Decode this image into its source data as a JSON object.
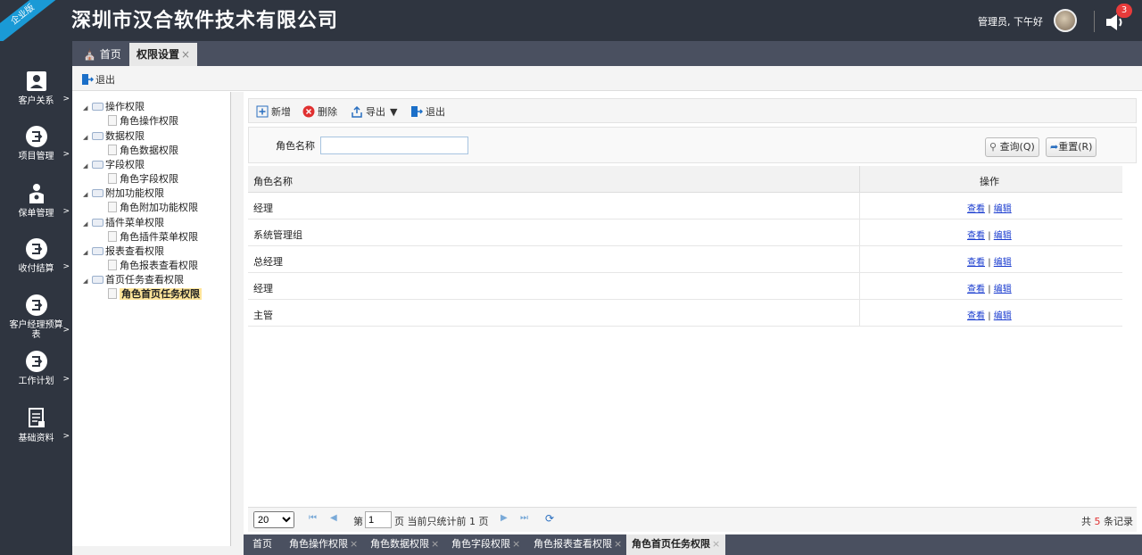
{
  "header": {
    "ribbon": "企业版",
    "company": "深圳市汉合软件技术有限公司",
    "user_greeting": "管理员, 下午好",
    "notification_count": "3"
  },
  "sidebar": {
    "items": [
      {
        "label": "客户关系",
        "icon": "contact-card-icon"
      },
      {
        "label": "项目管理",
        "icon": "module-icon"
      },
      {
        "label": "保单管理",
        "icon": "person-tool-icon"
      },
      {
        "label": "收付结算",
        "icon": "module-icon"
      },
      {
        "label": "客户经理预算表",
        "icon": "module-icon"
      },
      {
        "label": "工作计划",
        "icon": "module-icon"
      },
      {
        "label": "基础资料",
        "icon": "document-icon"
      }
    ],
    "arrow": ">"
  },
  "tabs": [
    {
      "label": "首页"
    },
    {
      "label": "权限设置"
    }
  ],
  "top_toolbar": {
    "exit_label": "退出"
  },
  "tree": {
    "nodes": [
      {
        "label": "操作权限",
        "child": "角色操作权限"
      },
      {
        "label": "数据权限",
        "child": "角色数据权限"
      },
      {
        "label": "字段权限",
        "child": "角色字段权限"
      },
      {
        "label": "附加功能权限",
        "child": "角色附加功能权限"
      },
      {
        "label": "插件菜单权限",
        "child": "角色插件菜单权限"
      },
      {
        "label": "报表查看权限",
        "child": "角色报表查看权限"
      },
      {
        "label": "首页任务查看权限",
        "child": "角色首页任务权限"
      }
    ]
  },
  "toolbar": {
    "new": "新增",
    "delete": "删除",
    "export": "导出",
    "exit": "退出"
  },
  "search": {
    "label": "角色名称",
    "value": "",
    "query_button": "查询(Q)",
    "reset_button": "重置(R)"
  },
  "grid": {
    "columns": [
      "角色名称",
      "操作"
    ],
    "rows": [
      {
        "name": "经理"
      },
      {
        "name": "系统管理组"
      },
      {
        "name": "总经理"
      },
      {
        "name": "经理"
      },
      {
        "name": "主管"
      }
    ],
    "view_link": "查看",
    "edit_link": "编辑",
    "separator": "|"
  },
  "pager": {
    "page_size": "20",
    "page_prefix": "第",
    "page_value": "1",
    "page_suffix": "页 当前只统计前 1 页",
    "total_prefix": "共",
    "total_count": "5",
    "total_suffix": "条记录"
  },
  "bottom_tabs": [
    {
      "label": "首页"
    },
    {
      "label": "角色操作权限"
    },
    {
      "label": "角色数据权限"
    },
    {
      "label": "角色字段权限"
    },
    {
      "label": "角色报表查看权限"
    },
    {
      "label": "角色首页任务权限"
    }
  ],
  "colors": {
    "topbar": "#2f3540",
    "accent": "#1a9ad6",
    "link": "#1a3ccf",
    "badge": "#e83b3b",
    "selection": "#ffe59a"
  }
}
